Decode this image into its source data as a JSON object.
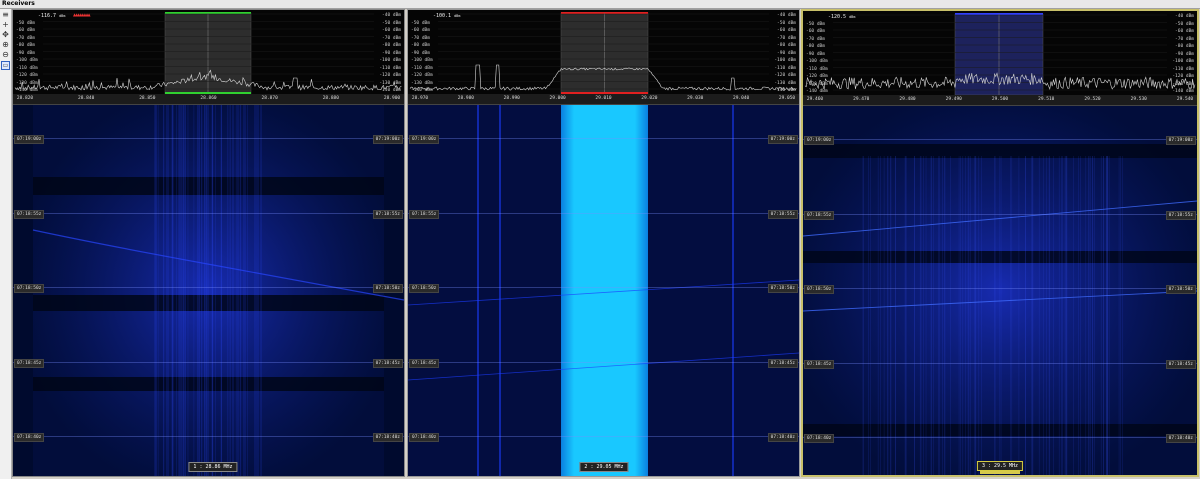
{
  "window": {
    "title": "Receivers"
  },
  "toolbar": {
    "tools": [
      {
        "name": "menu-icon",
        "glyph": "≡"
      },
      {
        "name": "add-icon",
        "glyph": "+"
      },
      {
        "name": "pan-icon",
        "glyph": "✥"
      },
      {
        "name": "zoom-in-icon",
        "glyph": "⊕"
      },
      {
        "name": "zoom-out-icon",
        "glyph": "⊖"
      },
      {
        "name": "layout-icon",
        "glyph": "▭"
      }
    ]
  },
  "colors": {
    "spectrum_line": "#d8d8d8",
    "wf_dark": "#000a2e",
    "wf_mid": "#0a1fa0",
    "wf_bright": "#19c8ff",
    "filter_green": "#30d030",
    "filter_red": "#e02020",
    "filter_blue": "#3040ff",
    "selected_border": "#c8c06a"
  },
  "db_scale": [
    "-40 dBm",
    "-50 dBm",
    "-60 dBm",
    "-70 dBm",
    "-80 dBm",
    "-90 dBm",
    "-100 dBm",
    "-110 dBm",
    "-120 dBm",
    "-130 dBm",
    "-140 dBm"
  ],
  "time_labels": [
    "07:19:00z",
    "07:18:55z",
    "07:18:50z",
    "07:18:45z",
    "07:18:40z"
  ],
  "receivers": [
    {
      "level": "-116.7",
      "unit": "dBm",
      "freq_ticks": [
        "28.820",
        "28.840",
        "28.850",
        "28.860",
        "28.870",
        "28.880",
        "28.900"
      ],
      "channel_label": "1 : 28.86 MHz",
      "filter_color": "green"
    },
    {
      "level": "-100.1",
      "unit": "dBm",
      "freq_ticks": [
        "28.970",
        "28.980",
        "28.990",
        "29.000",
        "29.010",
        "29.020",
        "29.030",
        "29.040",
        "29.050"
      ],
      "channel_label": "2 : 29.05 MHz",
      "filter_color": "red"
    },
    {
      "level": "-120.5",
      "unit": "dBm",
      "freq_ticks": [
        "29.460",
        "29.470",
        "29.480",
        "29.490",
        "29.500",
        "29.510",
        "29.520",
        "29.530",
        "29.540"
      ],
      "channel_label": "3 : 29.5 MHz",
      "filter_color": "blue"
    }
  ]
}
